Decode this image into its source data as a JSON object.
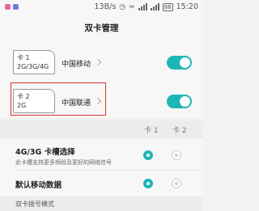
{
  "colors": {
    "accent": "#1cb6b4",
    "highlight": "#e03030",
    "status_dot_1": "#e8669a",
    "status_dot_2": "#6d7fd9"
  },
  "status_bar": {
    "speed": "13B/s",
    "battery": "88",
    "time": "15:20"
  },
  "header": {
    "title": "双卡管理"
  },
  "sims": [
    {
      "slot": "卡 1",
      "type": "2G/3G/4G",
      "carrier": "中国移动",
      "enabled": true
    },
    {
      "slot": "卡 2",
      "type": "2G",
      "carrier": "中国联通",
      "enabled": true
    }
  ],
  "preferences": {
    "columns": [
      "卡 1",
      "卡 2"
    ],
    "rows": [
      {
        "title": "4G/3G 卡槽选择",
        "subtitle": "此卡槽支持更多频段及更好的网络信号",
        "selected": "卡 1"
      },
      {
        "title": "默认移动数据",
        "subtitle": "",
        "selected": "卡 1"
      }
    ]
  },
  "footer": {
    "section_label": "双卡拨号模式"
  }
}
